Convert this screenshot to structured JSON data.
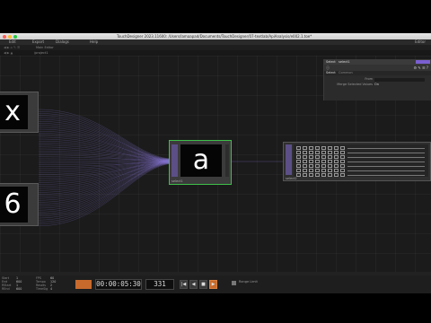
{
  "window": {
    "title": "TouchDesigner 2023.11600: /Users/lamaapad/Documents/TouchDesigner/07-textlab/ApiAnalysis/e002.1.toe*"
  },
  "menubar": {
    "items": [
      "Edit",
      "Export",
      "Dialogs",
      "Help"
    ],
    "right_label": "Editor"
  },
  "toolbar": {
    "path_text": "/project1",
    "tab_label": "Main Editor"
  },
  "network": {
    "nodes": {
      "text_x": {
        "glyph": "x"
      },
      "text_6": {
        "glyph": "6"
      },
      "text_a": {
        "glyph": "a",
        "label": "select1"
      },
      "table": {
        "label": "select2"
      }
    }
  },
  "parameters": {
    "header": "Select",
    "op_name": "select1",
    "tabs": [
      "Select",
      "Common"
    ],
    "rows": [
      {
        "name": "From",
        "value": ""
      },
      {
        "name": "Merge Selected Values",
        "value": "On"
      }
    ]
  },
  "timeline": {
    "timecode": "00:00:05:30",
    "frame": "331",
    "range_label": "Range Limit",
    "stats_left": [
      "Start",
      "End",
      "RStart",
      "REnd"
    ],
    "stats_values": [
      "1",
      "600",
      "1",
      "600"
    ],
    "stats_right": [
      "FPS",
      "Tempo",
      "Resets",
      "TimeSig"
    ],
    "stats_right_values": [
      "60",
      "120",
      "2",
      "4"
    ],
    "buttons": [
      "|◀",
      "◀",
      "■",
      "▶"
    ]
  }
}
